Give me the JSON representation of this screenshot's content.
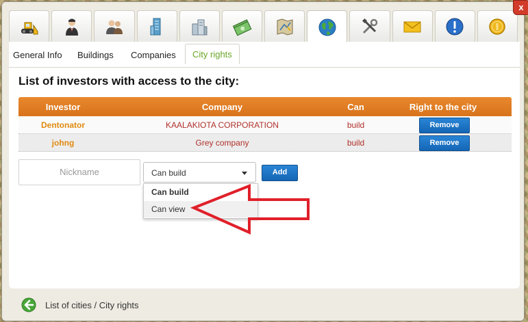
{
  "toolbar": {
    "icons": [
      "bulldozer-icon",
      "investor-icon",
      "users-icon",
      "skyscraper-icon",
      "buildings-icon",
      "money-icon",
      "map-icon",
      "globe-icon",
      "tools-icon",
      "mail-icon",
      "alert-icon",
      "coin-icon"
    ],
    "active_index": 7
  },
  "close_label": "x",
  "subtabs": {
    "general": "General Info",
    "buildings": "Buildings",
    "companies": "Companies",
    "city_rights": "City rights"
  },
  "heading": "List of investors with access to the city:",
  "table": {
    "headers": [
      "Investor",
      "Company",
      "Can",
      "Right to the city"
    ],
    "rows": [
      {
        "investor": "Dentonator",
        "company": "KAALAKIOTA CORPORATION",
        "can": "build",
        "action": "Remove"
      },
      {
        "investor": "johng",
        "company": "Grey company",
        "can": "build",
        "action": "Remove"
      }
    ]
  },
  "form": {
    "nickname_placeholder": "Nickname",
    "select_value": "Can build",
    "add_label": "Add",
    "options": [
      "Can build",
      "Can view"
    ]
  },
  "footer": {
    "breadcrumb": "List of cities / City rights"
  },
  "colors": {
    "header_orange": "#e07d22",
    "button_blue": "#1d74c6",
    "active_tab_green": "#6aa527",
    "annotation_red": "#e0202a"
  }
}
